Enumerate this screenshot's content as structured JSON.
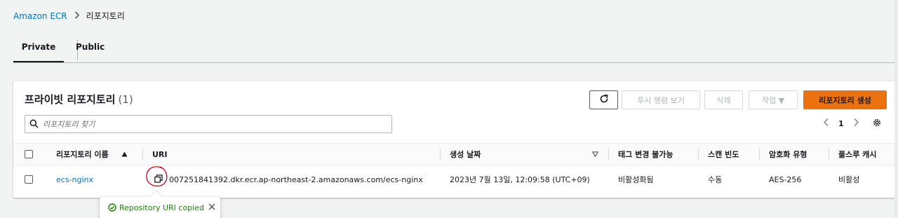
{
  "breadcrumb": {
    "root": "Amazon ECR",
    "current": "리포지토리"
  },
  "tabs": [
    {
      "label": "Private"
    },
    {
      "label": "Public"
    }
  ],
  "panel": {
    "title": "프라이빗 리포지토리",
    "count": "(1)",
    "buttons": {
      "push_commands": "푸시 명령 보기",
      "delete": "삭제",
      "actions": "작업 ▼",
      "create": "리포지토리 생성"
    },
    "search": {
      "placeholder": "리포지토리 찾기",
      "value": ""
    },
    "pagination": {
      "page": "1"
    }
  },
  "table": {
    "headers": {
      "name": "리포지토리 이름",
      "uri": "URI",
      "created": "생성 날짜",
      "immutability": "태그 변경 불가능",
      "scan": "스캔 빈도",
      "encryption": "암호화 유형",
      "cache": "풀스루 캐시"
    },
    "rows": [
      {
        "name": "ecs-nginx",
        "uri": "007251841392.dkr.ecr.ap-northeast-2.amazonaws.com/ecs-nginx",
        "created": "2023년 7월 13일, 12:09:58 (UTC+09)",
        "immutability": "비활성화됨",
        "scan": "수동",
        "encryption": "AES-256",
        "cache": "비활성"
      }
    ]
  },
  "toast": {
    "message": "Repository URI copied"
  },
  "colors": {
    "link": "#0073bb",
    "primary": "#ec7211",
    "success": "#1d8102",
    "annotation": "#d0021b"
  },
  "icons": [
    "chevron-right-icon",
    "refresh-icon",
    "search-icon",
    "chevron-left-icon",
    "gear-icon",
    "sort-asc-icon",
    "sort-desc-icon",
    "copy-icon",
    "check-circle-icon",
    "close-icon"
  ]
}
